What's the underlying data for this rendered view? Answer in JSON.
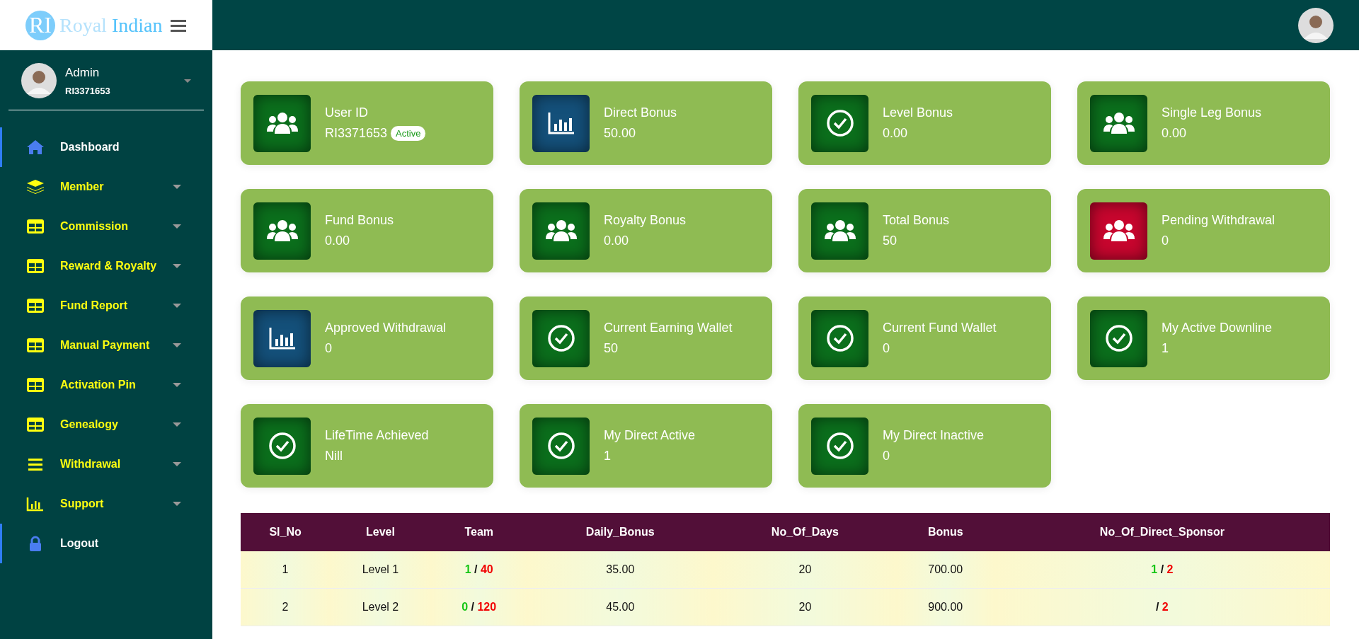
{
  "brand": {
    "mark": "RI",
    "name_part1": "Royal",
    "name_part2": "Indian"
  },
  "sidebar": {
    "user": {
      "name": "Admin",
      "id": "RI3371653"
    },
    "items": [
      {
        "label": "Dashboard",
        "kind": "link"
      },
      {
        "label": "Member",
        "kind": "menu"
      },
      {
        "label": "Commission",
        "kind": "menu"
      },
      {
        "label": "Reward & Royalty",
        "kind": "menu"
      },
      {
        "label": "Fund Report",
        "kind": "menu"
      },
      {
        "label": "Manual Payment",
        "kind": "menu"
      },
      {
        "label": "Activation Pin",
        "kind": "menu"
      },
      {
        "label": "Genealogy",
        "kind": "menu"
      },
      {
        "label": "Withdrawal",
        "kind": "menu"
      },
      {
        "label": "Support",
        "kind": "menu"
      },
      {
        "label": "Logout",
        "kind": "link"
      }
    ]
  },
  "cards": [
    {
      "title": "User ID",
      "value": "RI3371653",
      "badge": "Active",
      "kind": "users",
      "color": "#0b6f1c"
    },
    {
      "title": "Direct Bonus",
      "value": "50.00",
      "kind": "chart",
      "color": "#14507a"
    },
    {
      "title": "Level Bonus",
      "value": "0.00",
      "kind": "check",
      "color": "#0b6f1c"
    },
    {
      "title": "Single Leg Bonus",
      "value": "0.00",
      "kind": "users",
      "color": "#0b6f1c"
    },
    {
      "title": "Fund Bonus",
      "value": "0.00",
      "kind": "users",
      "color": "#0b6f1c"
    },
    {
      "title": "Royalty Bonus",
      "value": "0.00",
      "kind": "users",
      "color": "#0b6f1c"
    },
    {
      "title": "Total Bonus",
      "value": "50",
      "kind": "users",
      "color": "#0b6f1c"
    },
    {
      "title": "Pending Withdrawal",
      "value": "0",
      "kind": "users",
      "color": "#c8062e"
    },
    {
      "title": "Approved Withdrawal",
      "value": "0",
      "kind": "chart",
      "color": "#14507a"
    },
    {
      "title": "Current Earning Wallet",
      "value": "50",
      "kind": "check",
      "color": "#0b6f1c"
    },
    {
      "title": "Current Fund Wallet",
      "value": "0",
      "kind": "check",
      "color": "#0b6f1c"
    },
    {
      "title": "My Active Downline",
      "value": "1",
      "kind": "check",
      "color": "#0b6f1c"
    },
    {
      "title": "LifeTime Achieved",
      "value": "Nill",
      "kind": "check",
      "color": "#0b6f1c"
    },
    {
      "title": "My Direct Active",
      "value": "1",
      "kind": "check",
      "color": "#0b6f1c"
    },
    {
      "title": "My Direct Inactive",
      "value": "0",
      "kind": "check",
      "color": "#0b6f1c"
    }
  ],
  "table": {
    "columns": [
      "Sl_No",
      "Level",
      "Team",
      "Daily_Bonus",
      "No_Of_Days",
      "Bonus",
      "No_Of_Direct_Sponsor"
    ],
    "rows": [
      {
        "sl_no": "1",
        "level": "Level 1",
        "team": {
          "active": "1",
          "separator": "/",
          "total": "40"
        },
        "daily_bonus": "35.00",
        "days": "20",
        "bonus": "700.00",
        "sponsor": {
          "active": "1",
          "separator": "/",
          "total": "2"
        }
      },
      {
        "sl_no": "2",
        "level": "Level 2",
        "team": {
          "active": "0",
          "separator": "/",
          "total": "120"
        },
        "daily_bonus": "45.00",
        "days": "20",
        "bonus": "900.00",
        "sponsor": {
          "separator": "/",
          "total": "2"
        }
      }
    ]
  }
}
